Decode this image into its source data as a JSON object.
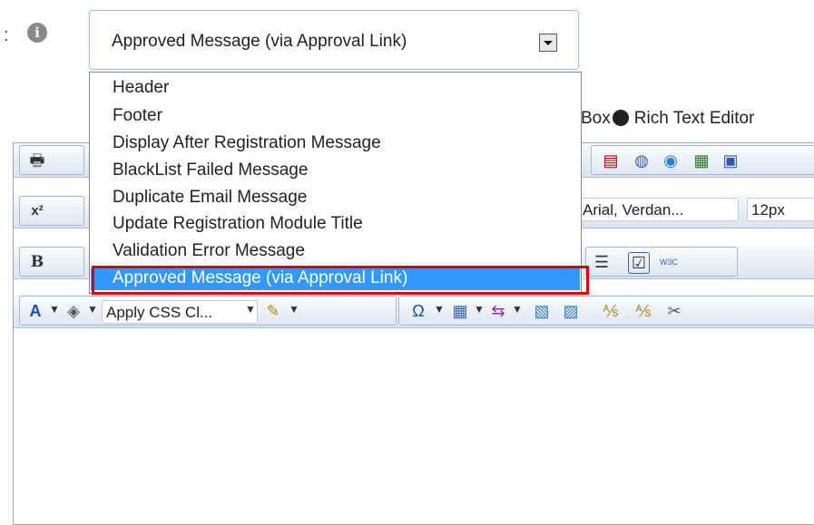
{
  "field": {
    "label_fragment": ":",
    "info_icon": "info-icon"
  },
  "select": {
    "value": "Approved Message (via Approval Link)",
    "arrow_icon": "chevron-down-icon"
  },
  "dropdown": {
    "items": [
      "Header",
      "Footer",
      "Display After Registration Message",
      "BlackList Failed Message",
      "Duplicate Email Message",
      "Update Registration Module Title",
      "Validation Error Message",
      "Approved Message (via Approval Link)"
    ],
    "selected_index": 7,
    "highlight_color": "#e00000",
    "selected_color": "#3399ff"
  },
  "editor_mode": {
    "basic_fragment": "Box",
    "rich_label": "Rich Text Editor"
  },
  "toolbar": {
    "font_name": "Arial, Verdan...",
    "font_size": "12px",
    "css_class": "Apply CSS Cl...",
    "bold": "B",
    "superscript": "x²",
    "font_color": "A",
    "omega": "Ω",
    "w3c": "W3C"
  }
}
